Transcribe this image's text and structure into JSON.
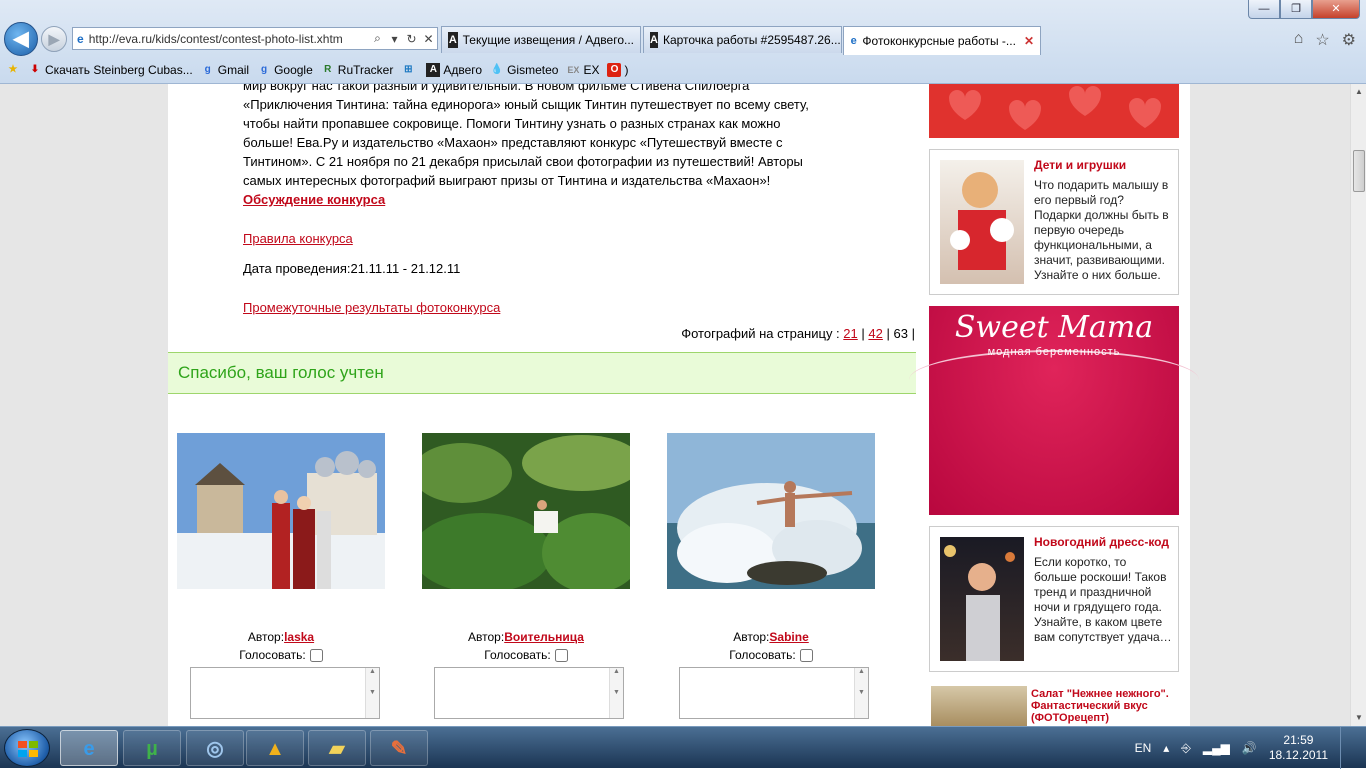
{
  "browser": {
    "address_url": "http://eva.ru/kids/contest/contest-photo-list.xhtm",
    "tabs": [
      {
        "label": "Текущие извещения / Адвего..."
      },
      {
        "label": "Карточка работы #2595487.26..."
      },
      {
        "label": "Фотоконкурсные работы -..."
      }
    ],
    "window_buttons": {
      "minimize": "—",
      "maximize": "❐",
      "close": "✕"
    },
    "favorites": [
      {
        "label": "Скачать Steinberg Cubas..."
      },
      {
        "label": "Gmail"
      },
      {
        "label": "Google"
      },
      {
        "label": "RuTracker"
      },
      {
        "label": ""
      },
      {
        "label": "Адвего"
      },
      {
        "label": "Gismeteo"
      },
      {
        "label": "EX"
      },
      {
        "label": ")"
      }
    ]
  },
  "content": {
    "description_lines": [
      "мир вокруг нас такой разный и удивительный. В новом фильме Стивена Спилберга",
      "«Приключения Тинтина: тайна единорога» юный сыщик Тинтин путешествует по всему свету,",
      "чтобы найти пропавшее сокровище. Помоги Тинтину узнать о разных странах как можно",
      "больше! Ева.Ру и издательство «Махаон» представляют конкурс «Путешествуй вместе с",
      "Тинтином». С 21 ноября по 21 декабря присылай свои фотографии из путешествий! Авторы",
      "самых интересных фотографий выиграют призы от Тинтина и издательства «Махаон»!"
    ],
    "discussion_link": "Обсуждение конкурса",
    "rules_link": "Правила конкурса",
    "dates": "Дата проведения:21.11.11 - 21.12.11",
    "results_link": "Промежуточные результаты фотоконкурса",
    "per_page": {
      "label": "Фотографий на страницу :",
      "opt1": "21",
      "opt2": "42",
      "current": "63",
      "sep": "|"
    },
    "thanks": "Спасибо, ваш голос учтен",
    "photos": [
      {
        "author_label": "Автор:",
        "author": "laska",
        "vote_label": "Голосовать:"
      },
      {
        "author_label": "Автор:",
        "author": "Воительница",
        "vote_label": "Голосовать:"
      },
      {
        "author_label": "Автор:",
        "author": "Sabine",
        "vote_label": "Голосовать:"
      }
    ]
  },
  "sidebar": {
    "ad1": {
      "title": "Дети и игрушки",
      "text": "Что подарить малышу в его первый год? Подарки должны быть в первую очередь функциональными, а значит, развивающими. Узнайте о них больше."
    },
    "sweet": {
      "logo": "Sweet Mama",
      "sub": "модная беременность"
    },
    "ad2": {
      "title": "Новогодний дресс-код",
      "text": "Если коротко, то больше роскоши! Таков тренд и праздничной ночи и грядущего года. Узнайте, в каком цвете вам сопутствует удача…"
    },
    "salad": {
      "title": "Салат \"Нежнее нежного\". Фантастический вкус (ФОТОрецепт)"
    }
  },
  "taskbar": {
    "lang": "EN",
    "time": "21:59",
    "date": "18.12.2011"
  },
  "colors": {
    "link": "#c1081a",
    "thanks_bg": "#e9fbd8",
    "thanks_text": "#2fa41a"
  }
}
